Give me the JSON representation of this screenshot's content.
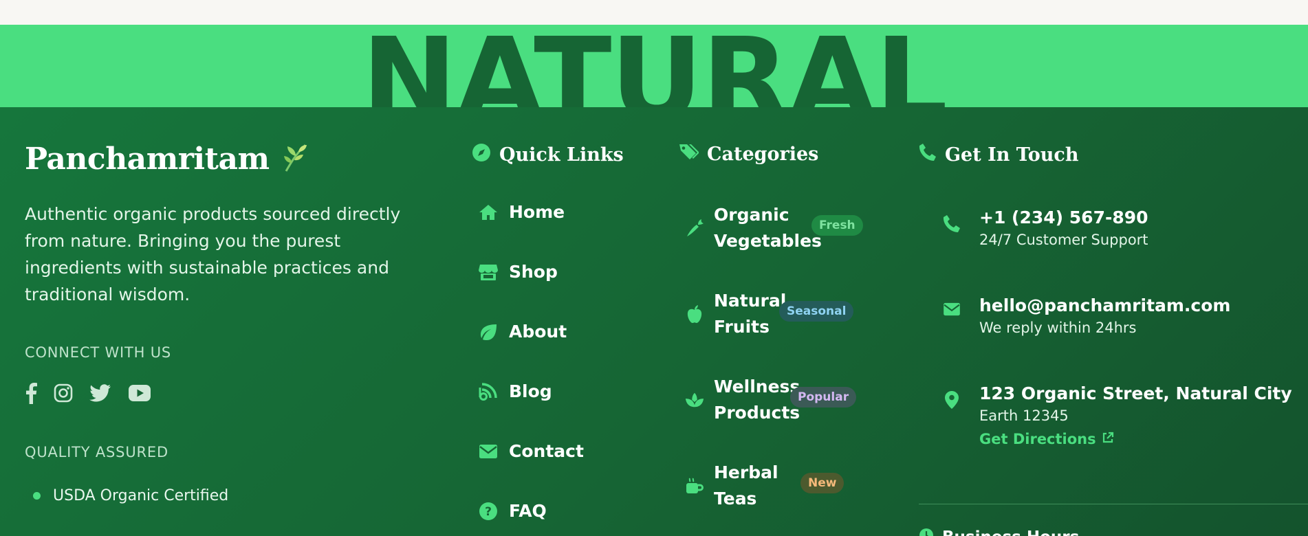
{
  "hero": {
    "word": "NATURAL"
  },
  "brand": {
    "name": "Panchamritam",
    "description": "Authentic organic products sourced directly from nature. Bringing you the purest ingredients with sustainable practices and traditional wisdom."
  },
  "connect": {
    "label": "CONNECT WITH US",
    "icons": [
      "facebook-icon",
      "instagram-icon",
      "twitter-icon",
      "youtube-icon"
    ]
  },
  "quality": {
    "label": "QUALITY ASSURED",
    "items": [
      "USDA Organic Certified"
    ]
  },
  "quick_links": {
    "title": "Quick Links",
    "items": [
      {
        "label": "Home",
        "icon": "home-icon"
      },
      {
        "label": "Shop",
        "icon": "store-icon"
      },
      {
        "label": "About",
        "icon": "leaf-icon"
      },
      {
        "label": "Blog",
        "icon": "blog-icon"
      },
      {
        "label": "Contact",
        "icon": "envelope-icon"
      },
      {
        "label": "FAQ",
        "icon": "question-icon"
      }
    ]
  },
  "categories": {
    "title": "Categories",
    "items": [
      {
        "line1": "Organic",
        "line2": "Vegetables",
        "badge": "Fresh",
        "icon": "carrot-icon"
      },
      {
        "line1": "Natural",
        "line2": "Fruits",
        "badge": "Seasonal",
        "icon": "apple-icon"
      },
      {
        "line1": "Wellness",
        "line2": "Products",
        "badge": "Popular",
        "icon": "spa-icon"
      },
      {
        "line1": "Herbal",
        "line2": "Teas",
        "badge": "New",
        "icon": "mug-icon"
      }
    ]
  },
  "contact": {
    "title": "Get In Touch",
    "phone": {
      "main": "+1 (234) 567-890",
      "sub": "24/7 Customer Support"
    },
    "email": {
      "main": "hello@panchamritam.com",
      "sub": "We reply within 24hrs"
    },
    "address": {
      "main": "123 Organic Street, Natural City",
      "sub": "Earth 12345",
      "link": "Get Directions"
    },
    "hours_title": "Business Hours"
  },
  "colors": {
    "accent": "#4ade80",
    "footer_bg": "#166534",
    "band_text": "#166534"
  }
}
